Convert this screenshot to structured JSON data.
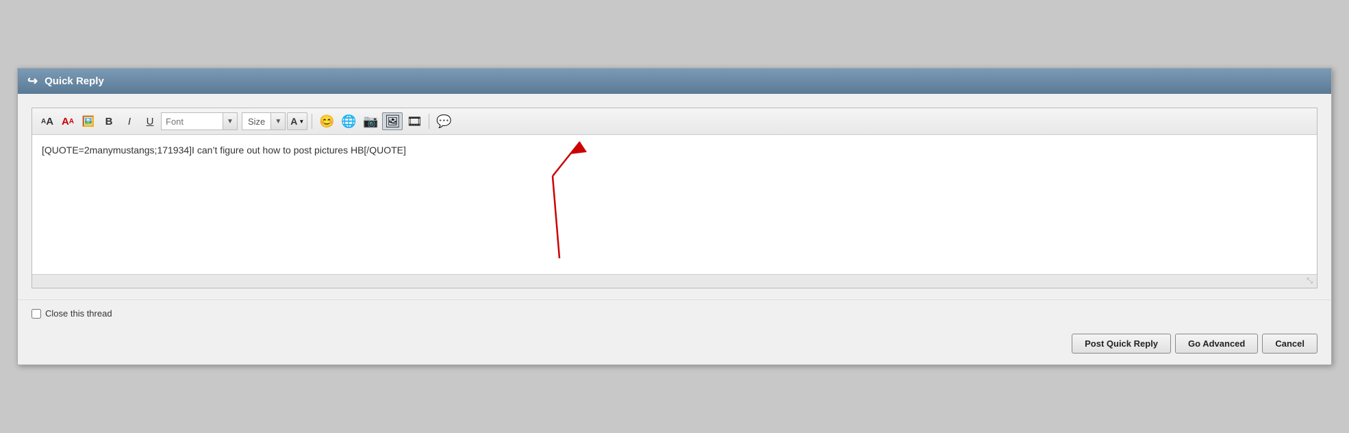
{
  "header": {
    "icon": "↩",
    "title": "Quick Reply"
  },
  "toolbar": {
    "font_label": "Font",
    "size_label": "Size",
    "buttons": [
      {
        "name": "font-size-decrease",
        "label": "A↓",
        "title": "Decrease Font Size"
      },
      {
        "name": "font-size-increase",
        "label": "A↑",
        "title": "Increase Font Size"
      },
      {
        "name": "remove-formatting",
        "label": "🖼",
        "title": "Remove Formatting"
      },
      {
        "name": "bold",
        "label": "B",
        "title": "Bold"
      },
      {
        "name": "italic",
        "label": "I",
        "title": "Italic"
      },
      {
        "name": "underline",
        "label": "U",
        "title": "Underline"
      }
    ],
    "icons": [
      {
        "name": "emoji-icon",
        "symbol": "😊",
        "title": "Insert Emoji"
      },
      {
        "name": "link-icon",
        "symbol": "🌐",
        "title": "Insert Link"
      },
      {
        "name": "image-icon",
        "symbol": "🖼",
        "title": "Insert Image"
      },
      {
        "name": "media-icon",
        "symbol": "📷",
        "title": "Insert Media"
      },
      {
        "name": "film-icon",
        "symbol": "🎞",
        "title": "Insert Film"
      },
      {
        "name": "comment-icon",
        "symbol": "💬",
        "title": "Insert Comment"
      }
    ]
  },
  "editor": {
    "content": "[QUOTE=2manymustangs;171934]I can’t figure out how to post pictures HB[/QUOTE]",
    "placeholder": ""
  },
  "footer": {
    "close_thread_label": "Close this thread"
  },
  "buttons": {
    "post_quick_reply": "Post Quick Reply",
    "go_advanced": "Go Advanced",
    "cancel": "Cancel"
  }
}
